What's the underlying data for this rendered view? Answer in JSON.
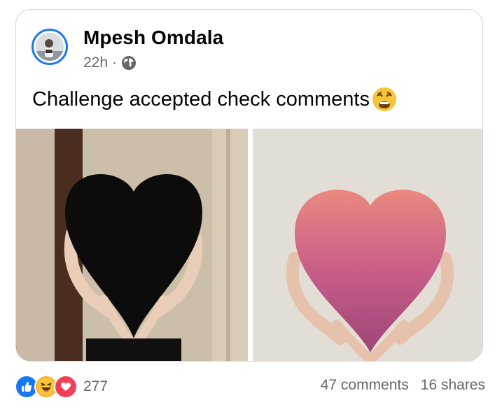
{
  "post": {
    "author": "Mpesh Omdala",
    "time": "22h",
    "separator": "·",
    "text": "Challenge accepted check comments",
    "privacy_icon": "globe-icon",
    "emoji_icon": "weary-face-emoji"
  },
  "reactions": {
    "icons": [
      "like-icon",
      "haha-icon",
      "love-icon"
    ],
    "count": "277"
  },
  "stats": {
    "comments": "47 comments",
    "shares": "16 shares"
  },
  "colors": {
    "accent": "#1877f2",
    "like": "#1877f2",
    "love": "#f33e58",
    "haha": "#f7b125",
    "secondary_text": "#65676b"
  }
}
